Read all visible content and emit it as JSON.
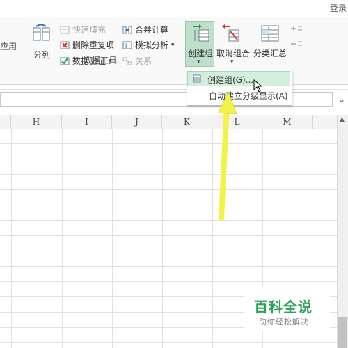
{
  "window": {
    "login_label": "登录"
  },
  "ribbon": {
    "apply_partial": "应用",
    "split_column": "分列",
    "flash_fill": "快速填充",
    "remove_duplicates": "删除重复项",
    "data_validation": "数据验证",
    "consolidate": "合并计算",
    "what_if": "模拟分析",
    "relationships": "关系",
    "group_label": "数据工具",
    "create_group": "创建组",
    "ungroup": "取消组合",
    "subtotal": "分类汇总"
  },
  "menu": {
    "item_group": "创建组(G)...",
    "item_auto_outline": "自动建立分级显示(A)"
  },
  "columns": [
    "H",
    "I",
    "J",
    "K",
    "L",
    "M"
  ],
  "watermark": {
    "title": "百科全说",
    "subtitle": "助你轻松解决"
  },
  "colors": {
    "accent_green": "#2fa05a",
    "active_button": "#bfe0c8",
    "arrow_yellow": "#f2f24a"
  }
}
